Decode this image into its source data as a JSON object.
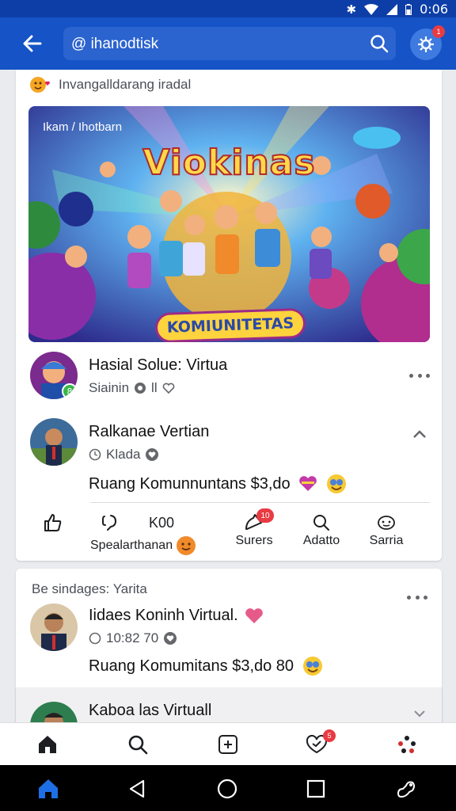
{
  "status_bar": {
    "time": "0:06"
  },
  "app_bar": {
    "search_value": "@ ihanodtisk",
    "profile_badge": "1"
  },
  "card1": {
    "group_header": "Invangalldarang iradal",
    "banner": {
      "caption": "Ikam / Ihotbarn",
      "title": "Viokinas",
      "subtitle": "KOMIUNITETAS"
    },
    "post1": {
      "title": "Hasial Solue: Virtua",
      "meta": "Siainin",
      "meta_count": "ll"
    },
    "post2": {
      "title": "Ralkanae Vertian",
      "meta": "Klada",
      "text": "Ruang Komunnuntans $3,do"
    },
    "actions": [
      {
        "label": "Spealarthanan",
        "top_label": "K00"
      },
      {
        "label": "Surers",
        "badge": "10"
      },
      {
        "label": "Adatto"
      },
      {
        "label": "Sarria"
      }
    ]
  },
  "card2": {
    "header": "Be sindages: Yarita",
    "post": {
      "title": "Iidaes Koninh Virtual.",
      "meta": "10:82 70",
      "text": "Ruang Komumitans $3,do 80"
    }
  },
  "card3": {
    "title": "Kaboa las Virtuall"
  },
  "bottom_nav": {
    "items": [
      "home",
      "search",
      "add",
      "notifications",
      "menu"
    ],
    "notifications_badge": "5"
  },
  "colors": {
    "brand": "#1553c6",
    "status_bar": "#0d3ea8",
    "badge": "#e83b43"
  }
}
